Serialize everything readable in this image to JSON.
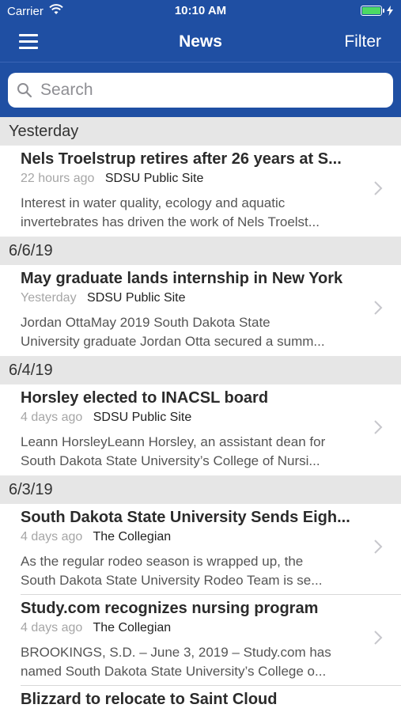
{
  "status_bar": {
    "carrier": "Carrier",
    "time": "10:10 AM",
    "battery_color": "#4cd964"
  },
  "nav": {
    "title": "News",
    "filter_label": "Filter",
    "menu_icon": "hamburger-menu-icon",
    "background": "#1f4fa3"
  },
  "search": {
    "placeholder": "Search"
  },
  "sections": [
    {
      "header": "Yesterday",
      "items": [
        {
          "title": "Nels Troelstrup retires after 26 years at S...",
          "ago": "22 hours ago",
          "source": "SDSU Public Site",
          "summary_line1": "Interest in water quality, ecology and aquatic",
          "summary_line2": "invertebrates has driven the work of Nels Troelst..."
        }
      ]
    },
    {
      "header": "6/6/19",
      "items": [
        {
          "title": "May graduate lands internship in New York",
          "ago": "Yesterday",
          "source": "SDSU Public Site",
          "summary_line1": "Jordan OttaMay 2019 South Dakota State",
          "summary_line2": "University graduate Jordan Otta secured a summ..."
        }
      ]
    },
    {
      "header": "6/4/19",
      "items": [
        {
          "title": "Horsley elected to INACSL board",
          "ago": "4 days ago",
          "source": "SDSU Public Site",
          "summary_line1": "Leann HorsleyLeann Horsley, an assistant dean for",
          "summary_line2": "South Dakota State University’s College of Nursi..."
        }
      ]
    },
    {
      "header": "6/3/19",
      "items": [
        {
          "title": "South Dakota State University Sends Eigh...",
          "ago": "4 days ago",
          "source": "The Collegian",
          "summary_line1": "As the regular rodeo season is wrapped up, the",
          "summary_line2": "South Dakota State University Rodeo Team is se..."
        },
        {
          "title": "Study.com recognizes nursing program",
          "ago": "4 days ago",
          "source": "The Collegian",
          "summary_line1": "BROOKINGS, S.D. – June 3, 2019 – Study.com has",
          "summary_line2": "named South Dakota State University’s College o..."
        },
        {
          "title": "Blizzard to relocate to Saint Cloud"
        }
      ]
    }
  ]
}
